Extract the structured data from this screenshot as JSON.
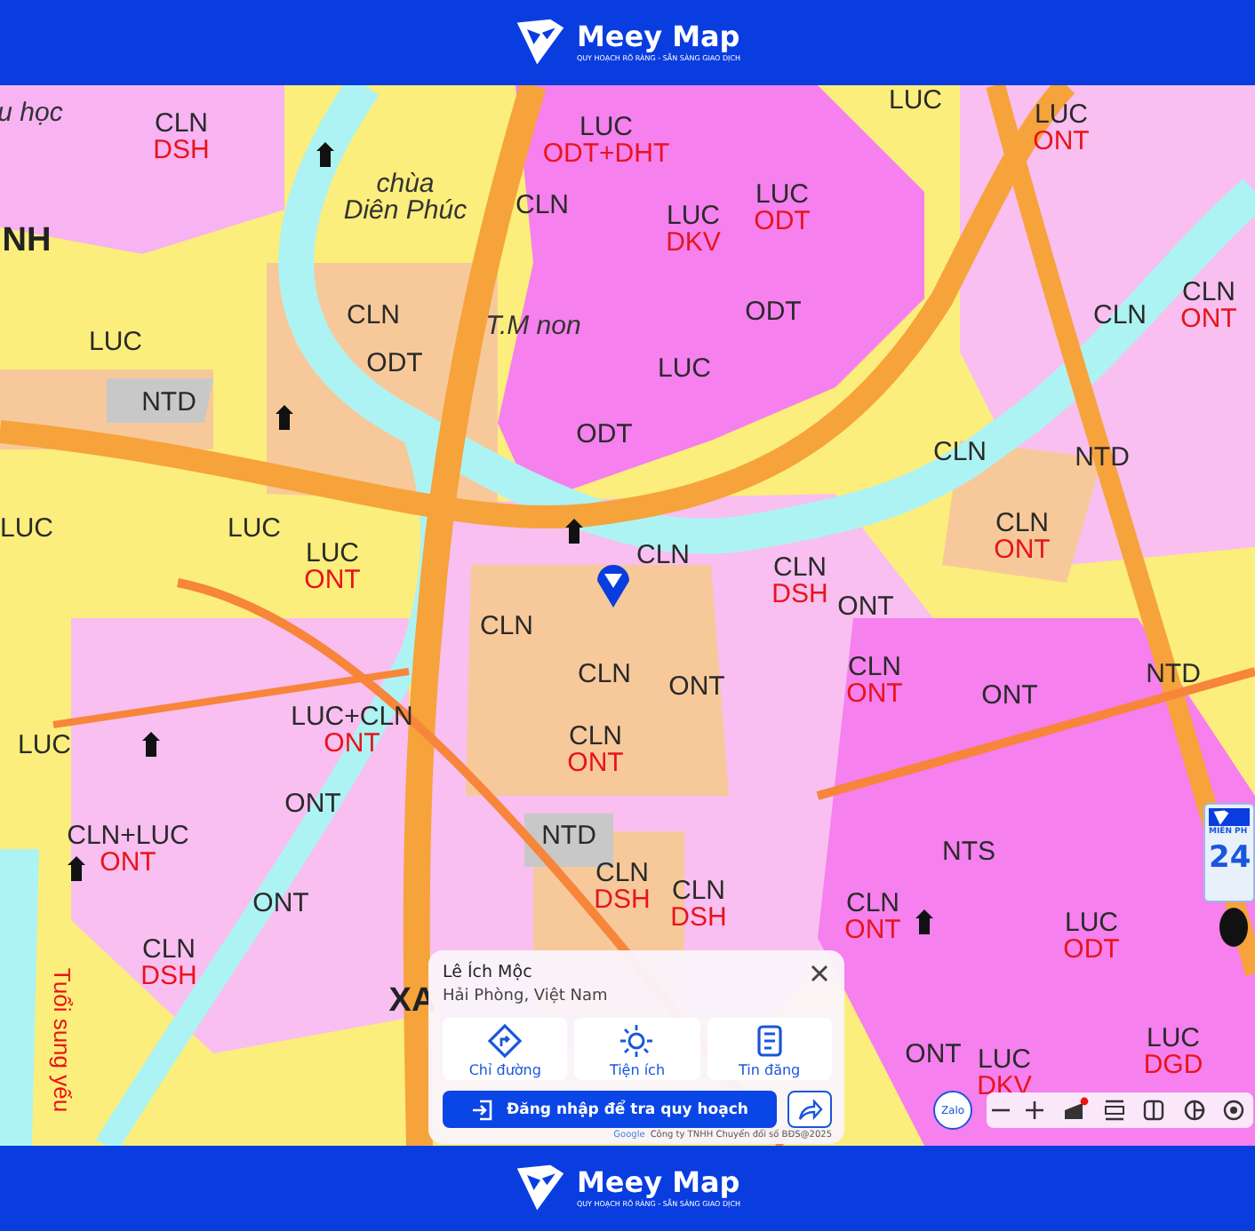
{
  "header": {
    "brand": "Meey Map",
    "tagline": "QUY HOẠCH RÕ RÀNG - SẴN SÀNG GIAO DỊCH"
  },
  "map": {
    "labels": [
      {
        "kind": "place",
        "lines": [
          "u học"
        ]
      },
      {
        "kind": "zone",
        "code": "CLN",
        "sub": "DSH"
      },
      {
        "kind": "area",
        "lines": [
          "NH"
        ]
      },
      {
        "kind": "place",
        "lines": [
          "chùa",
          "Diên Phúc"
        ]
      },
      {
        "kind": "zone",
        "code": "LUC",
        "sub": "ODT+DHT"
      },
      {
        "kind": "zone",
        "code": "CLN"
      },
      {
        "kind": "zone",
        "code": "LUC",
        "sub": "DKV"
      },
      {
        "kind": "zone",
        "code": "LUC",
        "sub": "ODT"
      },
      {
        "kind": "place",
        "lines": [
          "T.M non"
        ]
      },
      {
        "kind": "zone",
        "code": "CLN"
      },
      {
        "kind": "zone",
        "code": "ODT"
      },
      {
        "kind": "zone",
        "code": "ODT"
      },
      {
        "kind": "zone",
        "code": "LUC"
      },
      {
        "kind": "zone",
        "code": "LUC"
      },
      {
        "kind": "zone",
        "code": "NTD"
      },
      {
        "kind": "zone",
        "code": "ODT"
      },
      {
        "kind": "zone",
        "code": "LUC"
      },
      {
        "kind": "zone",
        "code": "LUC"
      },
      {
        "kind": "zone",
        "code": "LUC",
        "sub": "ONT"
      },
      {
        "kind": "zone",
        "code": "CLN"
      },
      {
        "kind": "zone",
        "code": "CLN",
        "sub": "DSH"
      },
      {
        "kind": "zone",
        "code": "ONT"
      },
      {
        "kind": "zone",
        "code": "CLN"
      },
      {
        "kind": "zone",
        "code": "CLN"
      },
      {
        "kind": "zone",
        "code": "ONT"
      },
      {
        "kind": "zone",
        "code": "CLN",
        "sub": "ONT"
      },
      {
        "kind": "zone",
        "code": "ONT"
      },
      {
        "kind": "zone",
        "code": "LUC"
      },
      {
        "kind": "zone",
        "code": "LUC+CLN",
        "sub": "ONT"
      },
      {
        "kind": "zone",
        "code": "CLN",
        "sub": "ONT"
      },
      {
        "kind": "zone",
        "code": "ONT"
      },
      {
        "kind": "zone",
        "code": "CLN+LUC",
        "sub": "ONT"
      },
      {
        "kind": "zone",
        "code": "NTD"
      },
      {
        "kind": "zone",
        "code": "NTS"
      },
      {
        "kind": "zone",
        "code": "ONT"
      },
      {
        "kind": "zone",
        "code": "CLN",
        "sub": "DSH"
      },
      {
        "kind": "zone",
        "code": "CLN",
        "sub": "ONT"
      },
      {
        "kind": "zone",
        "code": "LUC",
        "sub": "ODT"
      },
      {
        "kind": "zone",
        "code": "CLN",
        "sub": "DSH"
      },
      {
        "kind": "zone",
        "code": "CLN",
        "sub": "DSH"
      },
      {
        "kind": "area",
        "lines": [
          "XA"
        ]
      },
      {
        "kind": "zone",
        "code": "ONT"
      },
      {
        "kind": "zone",
        "code": "LUC",
        "sub": "DKV"
      },
      {
        "kind": "zone",
        "code": "LUC",
        "sub": "DGD"
      },
      {
        "kind": "zone",
        "code": "LUC"
      },
      {
        "kind": "zone",
        "code": "LUC",
        "sub": "ONT"
      },
      {
        "kind": "zone",
        "code": "CLN"
      },
      {
        "kind": "zone",
        "code": "CLN",
        "sub": "ONT"
      },
      {
        "kind": "zone",
        "code": "CLN"
      },
      {
        "kind": "zone",
        "code": "NTD"
      },
      {
        "kind": "zone",
        "code": "CLN",
        "sub": "ONT"
      },
      {
        "kind": "zone",
        "code": "NTD"
      },
      {
        "kind": "road",
        "lines": [
          "Tuổi sung yếu"
        ]
      }
    ],
    "promo": {
      "title": "MIỄN PH",
      "value": "24"
    }
  },
  "popup": {
    "title": "Lê Ích Mộc",
    "subtitle": "Hải Phòng, Việt Nam",
    "actions": [
      {
        "kind": "route",
        "label": "Chỉ đường"
      },
      {
        "kind": "amenity",
        "label": "Tiện ích"
      },
      {
        "kind": "listing",
        "label": "Tin đăng"
      }
    ],
    "login": "Đăng nhập để tra quy hoạch",
    "attribution": "Google",
    "copyright": "Công ty TNHH Chuyển đổi số BĐS@2025"
  },
  "toolbar": {
    "chat": "Zalo",
    "tools": [
      {
        "kind": "zoom-out"
      },
      {
        "kind": "zoom-in"
      },
      {
        "kind": "layers"
      },
      {
        "kind": "ruler"
      },
      {
        "kind": "split"
      },
      {
        "kind": "chart"
      },
      {
        "kind": "locate"
      }
    ]
  },
  "footer": {
    "brand": "Meey Map",
    "tagline": "QUY HOẠCH RÕ RÀNG - SẴN SÀNG GIAO DỊCH"
  }
}
